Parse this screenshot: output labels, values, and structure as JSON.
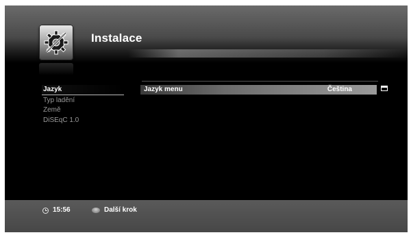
{
  "header": {
    "title": "Instalace",
    "icon": "settings-tools-icon"
  },
  "sidebar": {
    "items": [
      {
        "label": "Jazyk",
        "active": true
      },
      {
        "label": "Typ ladění",
        "active": false
      },
      {
        "label": "Země",
        "active": false
      },
      {
        "label": "DiSEqC 1.0",
        "active": false
      }
    ]
  },
  "main": {
    "setting": {
      "label": "Jazyk menu",
      "value": "Čeština",
      "icon": "dropdown-icon"
    }
  },
  "footer": {
    "time": "15:56",
    "time_icon": "clock-icon",
    "next_label": "Další krok",
    "next_icon": "color-key-button-icon"
  }
}
